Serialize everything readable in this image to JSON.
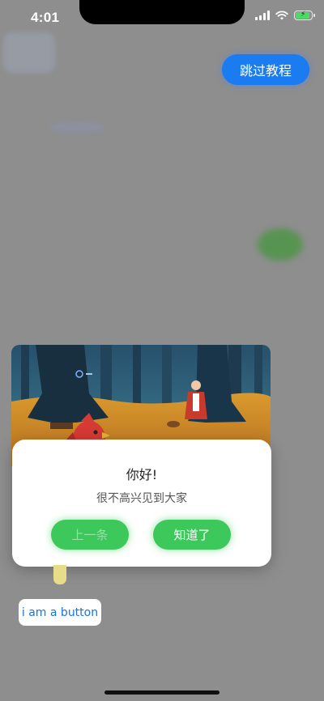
{
  "status_bar": {
    "time": "4:01",
    "battery_color": "#4cd964"
  },
  "onboarding": {
    "skip_label": "跳过教程"
  },
  "dialog": {
    "title": "你好!",
    "message": "很不高兴见到大家",
    "prev_label": "上一条",
    "ok_label": "知道了",
    "accent_color": "#3cc85a"
  },
  "page": {
    "button_label": "i am a button"
  },
  "icons": {
    "signal": "signal-icon",
    "wifi": "wifi-icon",
    "battery": "battery-icon",
    "illustration": "forest-illustration",
    "bird": "red-bird-icon"
  }
}
